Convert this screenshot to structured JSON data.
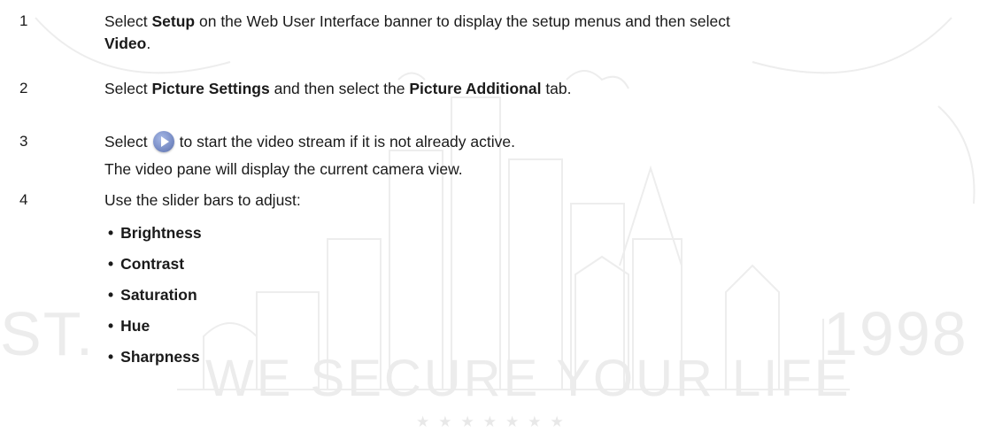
{
  "watermark": {
    "left_text": "ST.",
    "right_text": "1998",
    "motto": "WE SECURE YOUR LIFE",
    "stars": "★★★★★★★"
  },
  "steps": [
    {
      "number": "1",
      "text_1": "Select ",
      "bold_1": "Setup",
      "text_2": " on the Web User Interface banner to display the setup menus and then select",
      "bold_2": "Video",
      "text_3": "."
    },
    {
      "number": "2",
      "text_1": "Select ",
      "bold_1": "Picture Settings",
      "text_2": " and then select the ",
      "bold_2": "Picture Additional",
      "text_3": " tab."
    },
    {
      "number": "3",
      "text_1": "Select",
      "icon": "play-icon",
      "text_2": "to start the video stream if it is not already active.",
      "note": "The video pane will display the current camera view."
    },
    {
      "number": "4",
      "text_1": "Use the slider bars to adjust:",
      "bullets": [
        "Brightness",
        "Contrast",
        "Saturation",
        "Hue",
        "Sharpness"
      ]
    }
  ],
  "bullet_glyph": "•"
}
